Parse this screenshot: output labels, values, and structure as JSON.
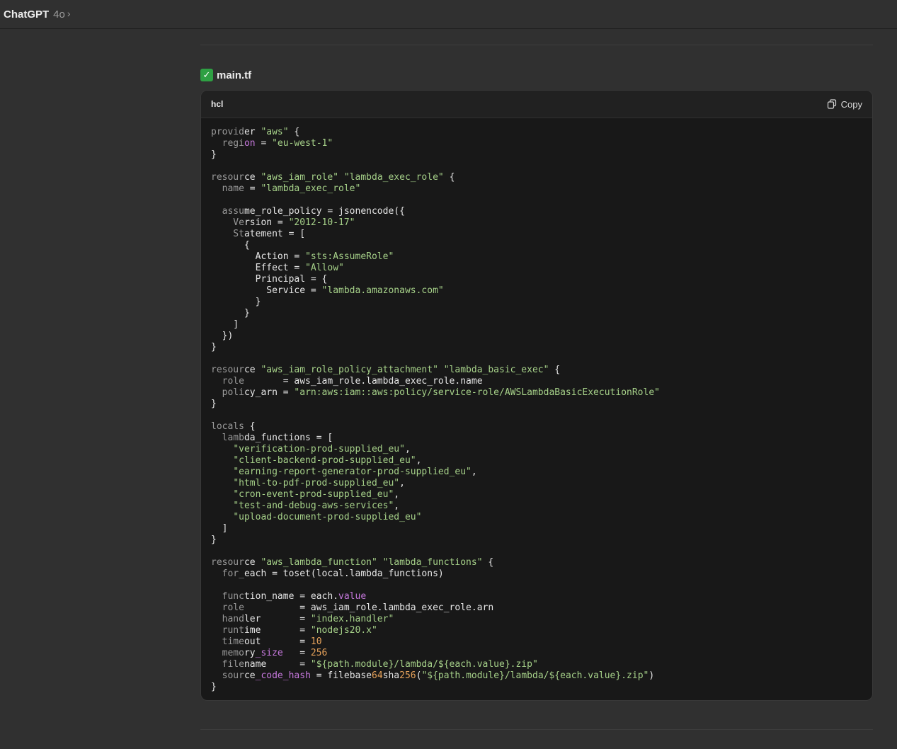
{
  "header": {
    "app_name": "ChatGPT",
    "model": "4o"
  },
  "message": {
    "file_check_icon": "check-mark-button-icon",
    "file_name": "main.tf"
  },
  "code_block": {
    "language": "hcl",
    "copy_label": "Copy",
    "lines": [
      [
        [
          "k",
          "provid"
        ],
        [
          "t",
          "er "
        ],
        [
          "s",
          "\"aws\""
        ],
        [
          "t",
          " {"
        ]
      ],
      [
        [
          "k",
          "  regi"
        ],
        [
          "p",
          "on"
        ],
        [
          "t",
          " = "
        ],
        [
          "s",
          "\"eu-west-1\""
        ]
      ],
      [
        [
          "t",
          "}"
        ]
      ],
      [],
      [
        [
          "k",
          "resour"
        ],
        [
          "t",
          "ce "
        ],
        [
          "s",
          "\"aws_iam_role\""
        ],
        [
          "t",
          " "
        ],
        [
          "s",
          "\"lambda_exec_role\""
        ],
        [
          "t",
          " {"
        ]
      ],
      [
        [
          "k",
          "  name"
        ],
        [
          "t",
          " = "
        ],
        [
          "s",
          "\"lambda_exec_role\""
        ]
      ],
      [],
      [
        [
          "k",
          "  assu"
        ],
        [
          "t",
          "me_role_policy = jsonencode({"
        ]
      ],
      [
        [
          "k",
          "    Ve"
        ],
        [
          "t",
          "rsion = "
        ],
        [
          "s",
          "\"2012-10-17\""
        ]
      ],
      [
        [
          "k",
          "    St"
        ],
        [
          "t",
          "atement = ["
        ]
      ],
      [
        [
          "t",
          "      {"
        ]
      ],
      [
        [
          "t",
          "        Action = "
        ],
        [
          "s",
          "\"sts:AssumeRole\""
        ]
      ],
      [
        [
          "t",
          "        Effect = "
        ],
        [
          "s",
          "\"Allow\""
        ]
      ],
      [
        [
          "t",
          "        Principal = {"
        ]
      ],
      [
        [
          "t",
          "          Service = "
        ],
        [
          "s",
          "\"lambda.amazonaws.com\""
        ]
      ],
      [
        [
          "t",
          "        }"
        ]
      ],
      [
        [
          "t",
          "      }"
        ]
      ],
      [
        [
          "t",
          "    ]"
        ]
      ],
      [
        [
          "t",
          "  })"
        ]
      ],
      [
        [
          "t",
          "}"
        ]
      ],
      [],
      [
        [
          "k",
          "resour"
        ],
        [
          "t",
          "ce "
        ],
        [
          "s",
          "\"aws_iam_role_policy_attachment\""
        ],
        [
          "t",
          " "
        ],
        [
          "s",
          "\"lambda_basic_exec\""
        ],
        [
          "t",
          " {"
        ]
      ],
      [
        [
          "k",
          "  role"
        ],
        [
          "t",
          "       = aws_iam_role.lambda_exec_role.name"
        ]
      ],
      [
        [
          "k",
          "  poli"
        ],
        [
          "t",
          "cy_arn = "
        ],
        [
          "s",
          "\"arn:aws:iam::aws:policy/service-role/AWSLambdaBasicExecutionRole\""
        ]
      ],
      [
        [
          "t",
          "}"
        ]
      ],
      [],
      [
        [
          "k",
          "locals"
        ],
        [
          "t",
          " {"
        ]
      ],
      [
        [
          "k",
          "  lamb"
        ],
        [
          "t",
          "da_functions = ["
        ]
      ],
      [
        [
          "t",
          "    "
        ],
        [
          "s",
          "\"verification-prod-supplied_eu\""
        ],
        [
          "t",
          ","
        ]
      ],
      [
        [
          "t",
          "    "
        ],
        [
          "s",
          "\"client-backend-prod-supplied_eu\""
        ],
        [
          "t",
          ","
        ]
      ],
      [
        [
          "t",
          "    "
        ],
        [
          "s",
          "\"earning-report-generator-prod-supplied_eu\""
        ],
        [
          "t",
          ","
        ]
      ],
      [
        [
          "t",
          "    "
        ],
        [
          "s",
          "\"html-to-pdf-prod-supplied_eu\""
        ],
        [
          "t",
          ","
        ]
      ],
      [
        [
          "t",
          "    "
        ],
        [
          "s",
          "\"cron-event-prod-supplied_eu\""
        ],
        [
          "t",
          ","
        ]
      ],
      [
        [
          "t",
          "    "
        ],
        [
          "s",
          "\"test-and-debug-aws-services\""
        ],
        [
          "t",
          ","
        ]
      ],
      [
        [
          "t",
          "    "
        ],
        [
          "s",
          "\"upload-document-prod-supplied_eu\""
        ]
      ],
      [
        [
          "t",
          "  ]"
        ]
      ],
      [
        [
          "t",
          "}"
        ]
      ],
      [],
      [
        [
          "k",
          "resour"
        ],
        [
          "t",
          "ce "
        ],
        [
          "s",
          "\"aws_lambda_function\""
        ],
        [
          "t",
          " "
        ],
        [
          "s",
          "\"lambda_functions\""
        ],
        [
          "t",
          " {"
        ]
      ],
      [
        [
          "k",
          "  for_"
        ],
        [
          "t",
          "each = toset(local.lambda_functions)"
        ]
      ],
      [],
      [
        [
          "k",
          "  func"
        ],
        [
          "t",
          "tion_name = each."
        ],
        [
          "p",
          "value"
        ]
      ],
      [
        [
          "k",
          "  role"
        ],
        [
          "t",
          "          = aws_iam_role.lambda_exec_role.arn"
        ]
      ],
      [
        [
          "k",
          "  hand"
        ],
        [
          "t",
          "ler       = "
        ],
        [
          "s",
          "\"index.handler\""
        ]
      ],
      [
        [
          "k",
          "  runt"
        ],
        [
          "t",
          "ime       = "
        ],
        [
          "s",
          "\"nodejs20.x\""
        ]
      ],
      [
        [
          "k",
          "  time"
        ],
        [
          "t",
          "out       = "
        ],
        [
          "n",
          "10"
        ]
      ],
      [
        [
          "k",
          "  memo"
        ],
        [
          "t",
          "ry"
        ],
        [
          "p",
          "_size"
        ],
        [
          "t",
          "   = "
        ],
        [
          "n",
          "256"
        ]
      ],
      [
        [
          "k",
          "  file"
        ],
        [
          "t",
          "name      = "
        ],
        [
          "s",
          "\"${path.module}/lambda/${each.value}.zip\""
        ]
      ],
      [
        [
          "k",
          "  sour"
        ],
        [
          "t",
          "ce"
        ],
        [
          "p",
          "_code_hash"
        ],
        [
          "t",
          " = filebase"
        ],
        [
          "n",
          "64"
        ],
        [
          "t",
          "sha"
        ],
        [
          "n",
          "256"
        ],
        [
          "t",
          "("
        ],
        [
          "s",
          "\"${path.module}/lambda/${each.value}.zip\""
        ],
        [
          "t",
          ")"
        ]
      ],
      [
        [
          "t",
          "}"
        ]
      ]
    ]
  }
}
